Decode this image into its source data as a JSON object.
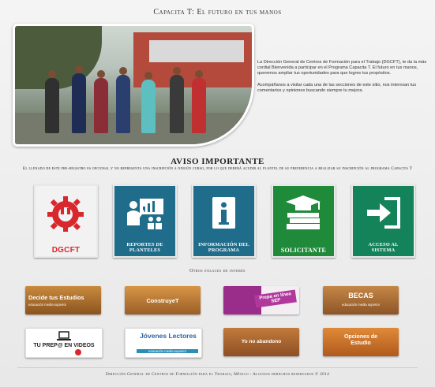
{
  "header": {
    "title": "Capacita T: El futuro en tus manos"
  },
  "intro": {
    "paragraph_1": "La Dirección General de Centros de Formación para el Trabajo (DGCFT), te da la más cordial Bienvenida a participar en el Programa Capacita T. El futuro en tus manos, queremos ampliar tus oportunidades para que logres tus propósitos.",
    "paragraph_2": "Acompáñanos a visitar cada una de las secciones de este sitio, nos interesan tus comentarios y opiniones buscando siempre tu mejora."
  },
  "notice": {
    "title": "AVISO IMPORTANTE",
    "text": "El llenado de este pre-registro es opcional y no representa una inscripción a ningún curso, por lo que deberá acudir al plantel de su preferencia a realizar su inscripción al programa Capacita T"
  },
  "tiles": [
    {
      "label": "DGCFT",
      "color": "#e9e9e9",
      "accent": "#d9282d"
    },
    {
      "label": "REPORTES DE PLANTELES",
      "color": "#1f6d8a"
    },
    {
      "label": "INFORMACIÓN DEL PROGRAMA",
      "color": "#1f6d8a"
    },
    {
      "label": "SOLICITANTE",
      "color": "#1f8a3a"
    },
    {
      "label": "ACCESO AL SISTEMA",
      "color": "#14835a"
    }
  ],
  "links": {
    "title": "Otros enlaces de interés",
    "items": [
      {
        "main": "Decide tus Estudios",
        "sub": "educación media superior",
        "color": "#b5762e"
      },
      {
        "main": "ConstruyeT",
        "sub": "",
        "color": "#c7873a"
      },
      {
        "main": "Prepa en línea SEP",
        "sub": "",
        "color": "#9b2d8a"
      },
      {
        "main": "BECAS",
        "sub": "educación media superior",
        "color": "#b67b3d"
      },
      {
        "main": "TU PREP@ EN VIDEOS",
        "sub": "",
        "color": "#ffffff"
      },
      {
        "main": "Jóvenes Lectores",
        "sub": "educación media superior",
        "color": "#ffffff"
      },
      {
        "main": "Yo no abandono",
        "sub": "",
        "color": "#b56b2f"
      },
      {
        "main": "Opciones de Estudio",
        "sub": "",
        "color": "#d97b2a"
      }
    ]
  },
  "footer": {
    "text": "Dirección General de Centros de Formación para el Trabajo, México - Algunos derechos reservados © 2014"
  }
}
